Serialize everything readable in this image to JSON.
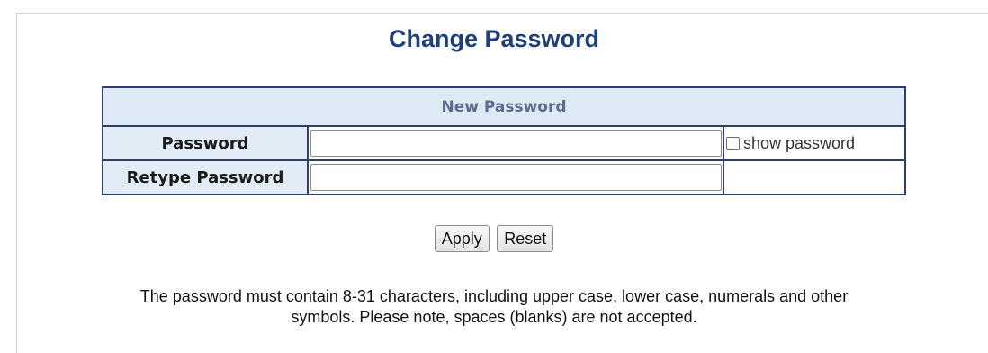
{
  "page": {
    "title": "Change Password"
  },
  "table": {
    "header": "New Password",
    "rows": [
      {
        "label": "Password",
        "value": "",
        "placeholder": ""
      },
      {
        "label": "Retype Password",
        "value": "",
        "placeholder": ""
      }
    ],
    "show_password_label": "show password",
    "show_password_checked": false
  },
  "buttons": {
    "apply": "Apply",
    "reset": "Reset"
  },
  "note": {
    "line1": "The password must contain 8-31 characters, including upper case, lower case, numerals and other",
    "line2": "symbols. Please note, spaces (blanks) are not accepted."
  },
  "colors": {
    "title": "#1f3f7a",
    "table_border": "#2f3e6b",
    "header_bg": "#dde9f5",
    "label_bg": "#e1ecf7"
  }
}
